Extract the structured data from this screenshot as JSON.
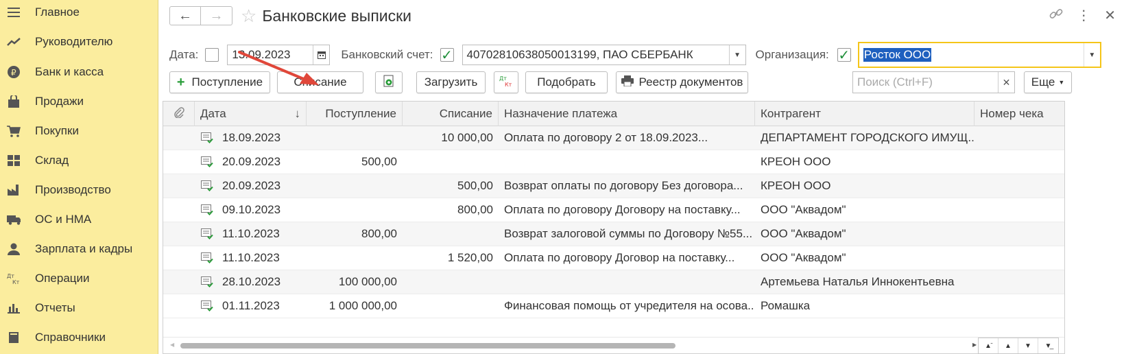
{
  "sidebar": {
    "items": [
      {
        "label": "Главное",
        "icon": "menu-icon"
      },
      {
        "label": "Руководителю",
        "icon": "trend-icon"
      },
      {
        "label": "Банк и касса",
        "icon": "ruble-coin-icon"
      },
      {
        "label": "Продажи",
        "icon": "shopping-bag-icon"
      },
      {
        "label": "Покупки",
        "icon": "cart-icon"
      },
      {
        "label": "Склад",
        "icon": "warehouse-grid-icon"
      },
      {
        "label": "Производство",
        "icon": "factory-icon"
      },
      {
        "label": "ОС и НМА",
        "icon": "truck-icon"
      },
      {
        "label": "Зарплата и кадры",
        "icon": "person-icon"
      },
      {
        "label": "Операции",
        "icon": "dt-kt-icon"
      },
      {
        "label": "Отчеты",
        "icon": "bar-chart-icon"
      },
      {
        "label": "Справочники",
        "icon": "book-icon"
      }
    ]
  },
  "header": {
    "title": "Банковские выписки"
  },
  "filters": {
    "date_label": "Дата:",
    "date_value": "13.09.2023",
    "account_label": "Банковский счет:",
    "account_value": "40702810638050013199, ПАО СБЕРБАНК",
    "org_label": "Организация:",
    "org_value": "Росток ООО"
  },
  "toolbar": {
    "income_label": "Поступление",
    "writeoff_label": "Списание",
    "load_label": "Загрузить",
    "dtkt_label": "Дт Кт",
    "pick_label": "Подобрать",
    "registry_label": "Реестр документов",
    "search_placeholder": "Поиск (Ctrl+F)",
    "more_label": "Еще"
  },
  "table": {
    "columns": [
      "Дата",
      "Поступление",
      "Списание",
      "Назначение платежа",
      "Контрагент",
      "Номер чека"
    ],
    "rows": [
      {
        "date": "18.09.2023",
        "income": "",
        "writeoff": "10 000,00",
        "purpose": "Оплата по договору 2 от 18.09.2023...",
        "contractor": "ДЕПАРТАМЕНТ ГОРОДСКОГО ИМУЩ...",
        "check": ""
      },
      {
        "date": "20.09.2023",
        "income": "500,00",
        "writeoff": "",
        "purpose": "",
        "contractor": "КРЕОН ООО",
        "check": ""
      },
      {
        "date": "20.09.2023",
        "income": "",
        "writeoff": "500,00",
        "purpose": "Возврат оплаты по договору Без договора...",
        "contractor": "КРЕОН ООО",
        "check": ""
      },
      {
        "date": "09.10.2023",
        "income": "",
        "writeoff": "800,00",
        "purpose": "Оплата по договору Договору на поставку...",
        "contractor": "ООО \"Аквадом\"",
        "check": ""
      },
      {
        "date": "11.10.2023",
        "income": "800,00",
        "writeoff": "",
        "purpose": "Возврат залоговой суммы  по Договору №55...",
        "contractor": "ООО \"Аквадом\"",
        "check": ""
      },
      {
        "date": "11.10.2023",
        "income": "",
        "writeoff": "1 520,00",
        "purpose": "Оплата по договору Договор на поставку...",
        "contractor": "ООО \"Аквадом\"",
        "check": ""
      },
      {
        "date": "28.10.2023",
        "income": "100 000,00",
        "writeoff": "",
        "purpose": "",
        "contractor": "Артемьева Наталья Иннокентьевна",
        "check": ""
      },
      {
        "date": "01.11.2023",
        "income": "1 000 000,00",
        "writeoff": "",
        "purpose": "Финансовая помощь от учредителя на осова...",
        "contractor": "Ромашка",
        "check": ""
      }
    ]
  },
  "colors": {
    "sidebar_bg": "#fbed9e",
    "accent_yellow": "#f5c518",
    "selection_blue": "#1e5fbf",
    "check_green": "#1f8f3a",
    "annotation_arrow": "#e0473a"
  }
}
